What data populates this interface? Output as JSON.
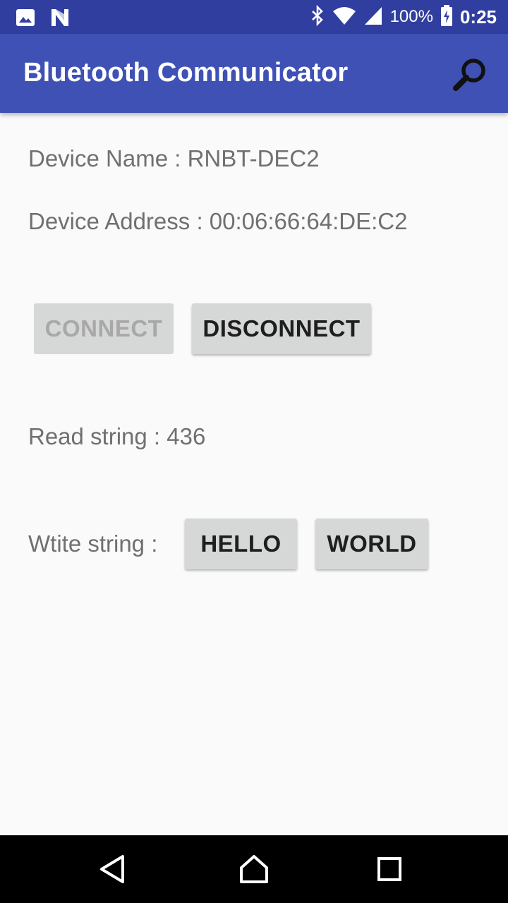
{
  "status_bar": {
    "left_icons": [
      "image-notification-icon",
      "n-notification-icon"
    ],
    "right_icons": [
      "bluetooth-icon",
      "wifi-icon",
      "cell-signal-icon",
      "battery-icon"
    ],
    "battery_text": "100%",
    "time": "0:25"
  },
  "app_bar": {
    "title": "Bluetooth Communicator",
    "action_icon": "search-icon",
    "color": "#3f51b5"
  },
  "device": {
    "name_text": "Device Name : RNBT-DEC2",
    "address_text": "Device Address : 00:06:66:64:DE:C2"
  },
  "buttons": {
    "connect": "CONNECT",
    "disconnect": "DISCONNECT",
    "hello": "HELLO",
    "world": "WORLD"
  },
  "read": {
    "text": "Read string : 436"
  },
  "write": {
    "label": "Wtite string :"
  },
  "nav_bar": {
    "icons": [
      "back-icon",
      "home-icon",
      "recents-icon"
    ]
  }
}
